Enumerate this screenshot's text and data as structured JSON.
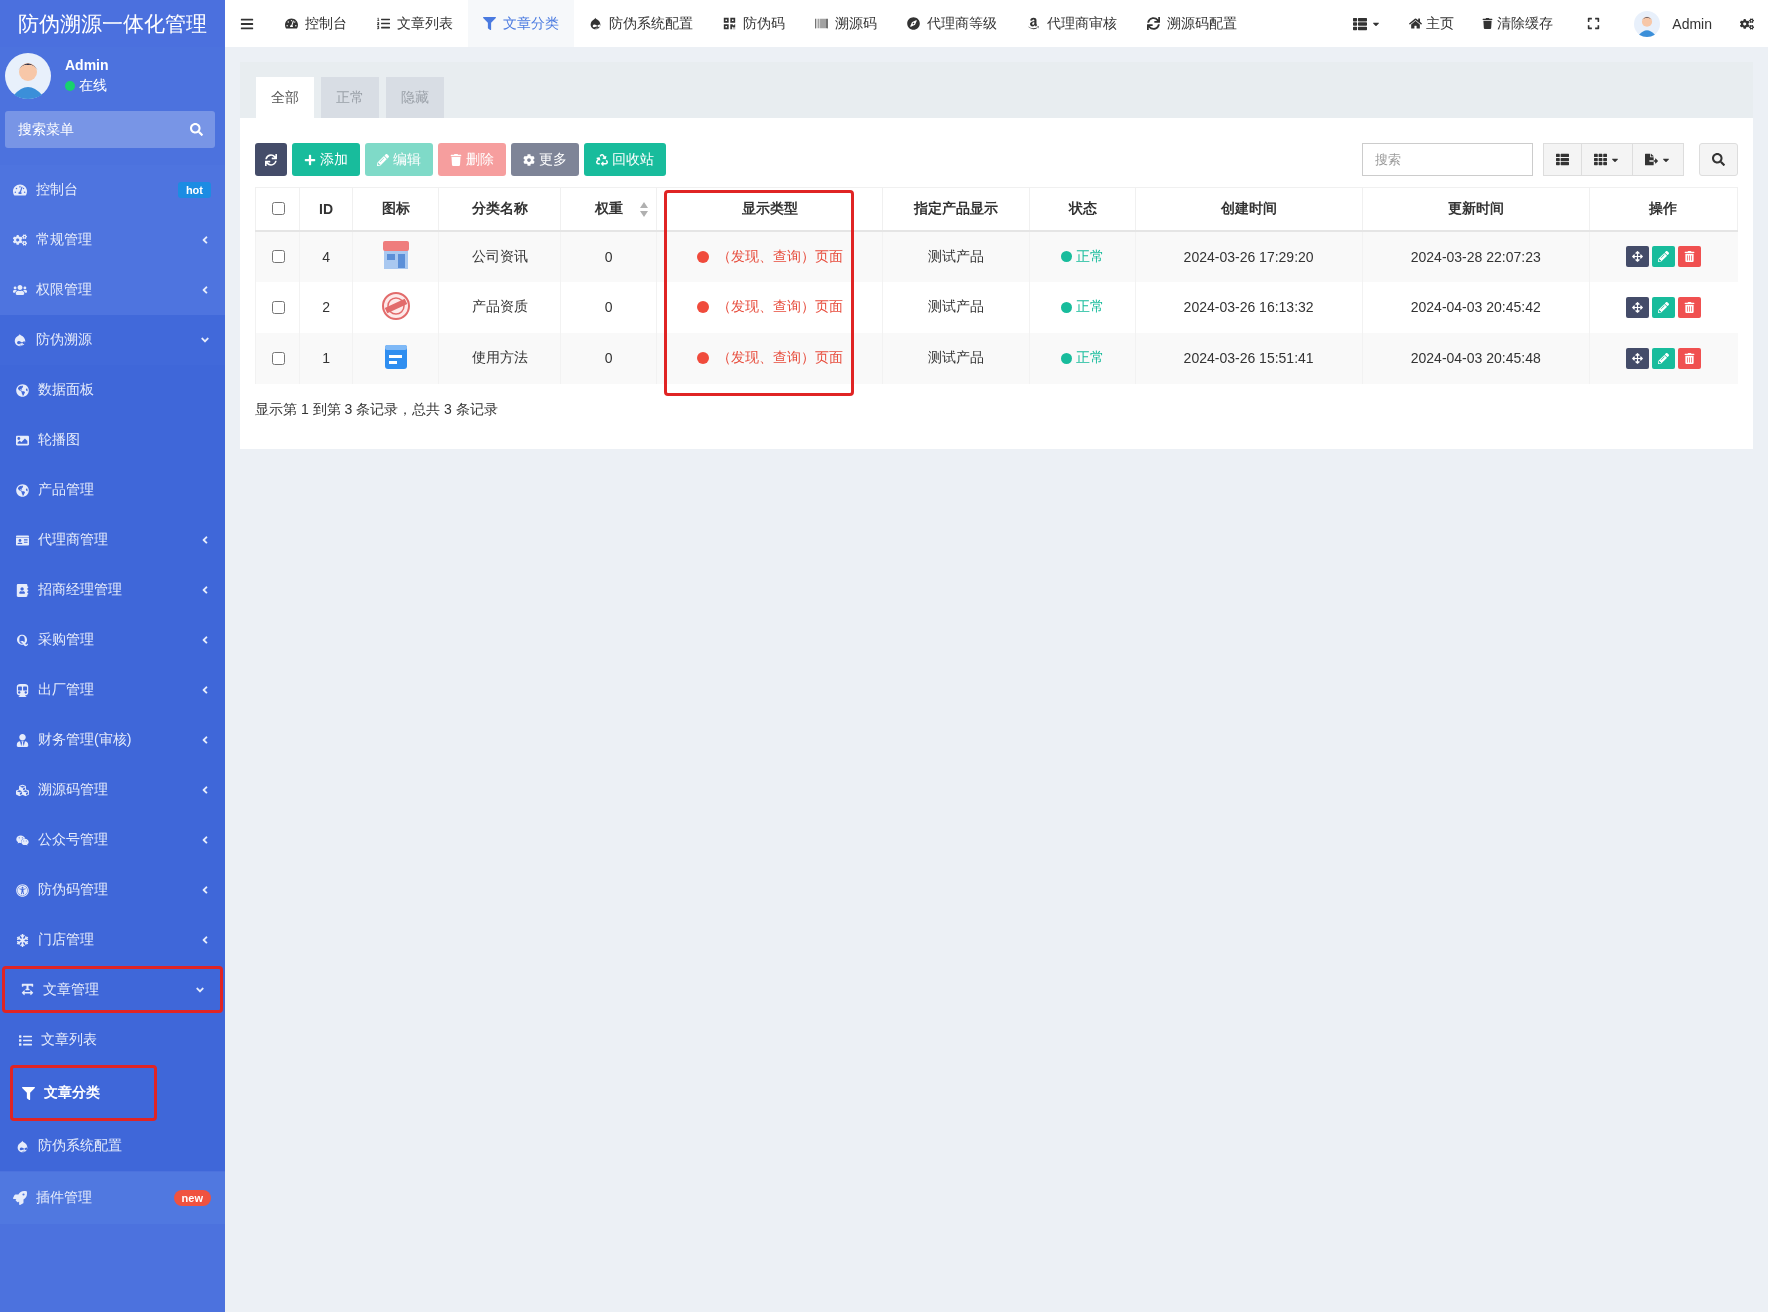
{
  "app_title": "防伪溯源一体化管理",
  "user": {
    "name": "Admin",
    "status": "在线",
    "online": true
  },
  "sidebar_search": {
    "placeholder": "搜索菜单"
  },
  "sidebar": {
    "items": [
      {
        "label": "控制台",
        "badge": "hot",
        "highlighted": false
      },
      {
        "label": "常规管理",
        "expanded": false,
        "highlighted": false
      },
      {
        "label": "权限管理",
        "expanded": false,
        "highlighted": false
      },
      {
        "label": "防伪溯源",
        "expanded": true,
        "highlighted": false,
        "children": [
          {
            "label": "数据面板",
            "highlighted": false
          },
          {
            "label": "轮播图",
            "highlighted": false
          },
          {
            "label": "产品管理",
            "highlighted": false
          },
          {
            "label": "代理商管理",
            "expanded": false,
            "highlighted": false
          },
          {
            "label": "招商经理管理",
            "expanded": false,
            "highlighted": false
          },
          {
            "label": "采购管理",
            "expanded": false,
            "highlighted": false
          },
          {
            "label": "出厂管理",
            "expanded": false,
            "highlighted": false
          },
          {
            "label": "财务管理(审核)",
            "expanded": false,
            "highlighted": false
          },
          {
            "label": "溯源码管理",
            "expanded": false,
            "highlighted": false
          },
          {
            "label": "公众号管理",
            "expanded": false,
            "highlighted": false
          },
          {
            "label": "防伪码管理",
            "expanded": false,
            "highlighted": false
          },
          {
            "label": "门店管理",
            "expanded": false,
            "highlighted": false
          },
          {
            "label": "文章管理",
            "expanded": true,
            "highlighted": true,
            "children": [
              {
                "label": "文章列表",
                "selected": false,
                "highlighted": false
              },
              {
                "label": "文章分类",
                "selected": true,
                "highlighted": true
              }
            ]
          },
          {
            "label": "防伪系统配置",
            "highlighted": false
          }
        ]
      },
      {
        "label": "插件管理",
        "badge": "new",
        "highlighted": false
      }
    ]
  },
  "top_tabs": [
    {
      "label": "控制台",
      "selected": false
    },
    {
      "label": "文章列表",
      "selected": false
    },
    {
      "label": "文章分类",
      "selected": true
    },
    {
      "label": "防伪系统配置",
      "selected": false
    },
    {
      "label": "防伪码",
      "selected": false
    },
    {
      "label": "溯源码",
      "selected": false
    },
    {
      "label": "代理商等级",
      "selected": false
    },
    {
      "label": "代理商审核",
      "selected": false
    },
    {
      "label": "溯源码配置",
      "selected": false
    }
  ],
  "top_right": {
    "home": "主页",
    "clear_cache": "清除缓存",
    "user": "Admin"
  },
  "content_tabs": [
    {
      "label": "全部",
      "selected": true
    },
    {
      "label": "正常",
      "selected": false
    },
    {
      "label": "隐藏",
      "selected": false
    }
  ],
  "toolbar": [
    {
      "kind": "refresh",
      "disabled": false
    },
    {
      "kind": "add",
      "label": "添加",
      "disabled": false
    },
    {
      "kind": "edit",
      "label": "编辑",
      "disabled": true
    },
    {
      "kind": "delete",
      "label": "删除",
      "disabled": true
    },
    {
      "kind": "more",
      "label": "更多",
      "disabled": false
    },
    {
      "kind": "recycle",
      "label": "回收站",
      "disabled": false
    }
  ],
  "table_search": {
    "placeholder": "搜索"
  },
  "table": {
    "select_all": {
      "checked": false
    },
    "columns": [
      {
        "label": "ID",
        "sortable": false,
        "highlighted": false
      },
      {
        "label": "图标",
        "sortable": false,
        "highlighted": false
      },
      {
        "label": "分类名称",
        "sortable": false,
        "highlighted": false
      },
      {
        "label": "权重",
        "sortable": true,
        "highlighted": false
      },
      {
        "label": "显示类型",
        "sortable": false,
        "highlighted": true
      },
      {
        "label": "指定产品显示",
        "sortable": false,
        "highlighted": false
      },
      {
        "label": "状态",
        "sortable": false,
        "highlighted": false
      },
      {
        "label": "创建时间",
        "sortable": false,
        "highlighted": false
      },
      {
        "label": "更新时间",
        "sortable": false,
        "highlighted": false
      },
      {
        "label": "操作",
        "sortable": false,
        "highlighted": false
      }
    ],
    "rows": [
      {
        "checked": false,
        "id": "4",
        "name": "公司资讯",
        "weight": "0",
        "display_type": "（发现、查询）页面",
        "product": "测试产品",
        "status": "正常",
        "created": "2024-03-26 17:29:20",
        "updated": "2024-03-28 22:07:23"
      },
      {
        "checked": false,
        "id": "2",
        "name": "产品资质",
        "weight": "0",
        "display_type": "（发现、查询）页面",
        "product": "测试产品",
        "status": "正常",
        "created": "2024-03-26 16:13:32",
        "updated": "2024-04-03 20:45:42"
      },
      {
        "checked": false,
        "id": "1",
        "name": "使用方法",
        "weight": "0",
        "display_type": "（发现、查询）页面",
        "product": "测试产品",
        "status": "正常",
        "created": "2024-03-26 15:51:41",
        "updated": "2024-04-03 20:45:48"
      }
    ]
  },
  "footer": "显示第 1 到第 3 条记录，总共 3 条记录"
}
